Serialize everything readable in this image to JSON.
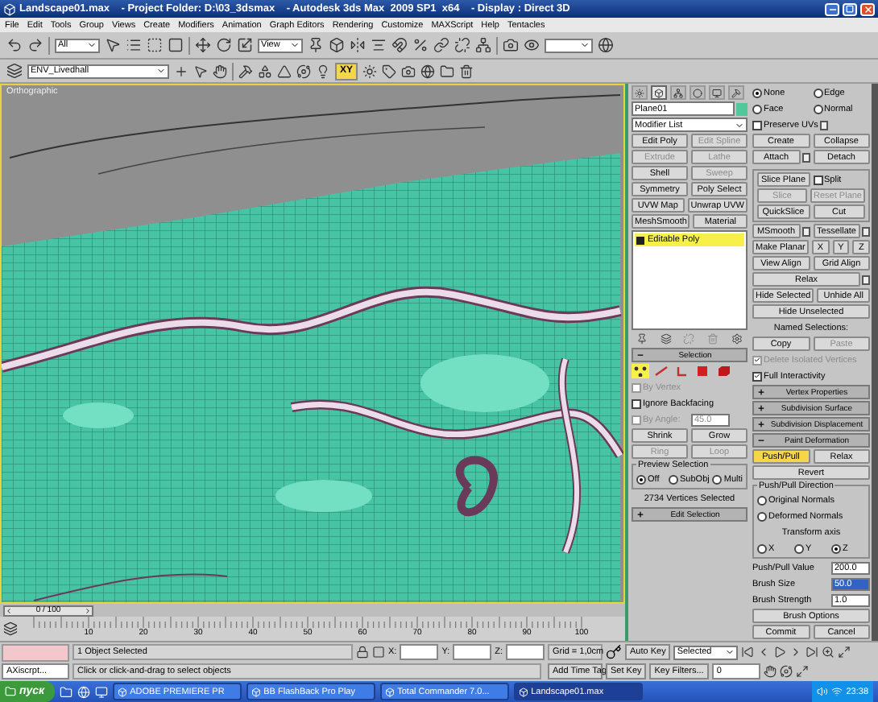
{
  "window": {
    "title": "Landscape01.max    - Project Folder: D:\\03_3dsmax    - Autodesk 3ds Max  2009 SP1  x64    - Display : Direct 3D"
  },
  "menu": [
    "File",
    "Edit",
    "Tools",
    "Group",
    "Views",
    "Create",
    "Modifiers",
    "Animation",
    "Graph Editors",
    "Rendering",
    "Customize",
    "MAXScript",
    "Help",
    "Tentacles"
  ],
  "main_toolbar": {
    "selection_filter": "All",
    "coordinate_system": "View"
  },
  "layer_toolbar": {
    "layer": "ENV_Livedhall",
    "constraint": {
      "label": "XY",
      "selected": true
    }
  },
  "viewport": {
    "label": "Orthographic"
  },
  "command_panel": {
    "tabs": [
      {
        "selected": false
      },
      {
        "selected": true
      },
      {
        "selected": false
      },
      {
        "selected": false
      },
      {
        "selected": false
      },
      {
        "selected": false
      }
    ],
    "left": [
      {
        "kind": "row",
        "items": [
          {
            "kind": "field",
            "value": "Plane01",
            "color": "#52c79c"
          }
        ]
      },
      {
        "kind": "row",
        "items": [
          {
            "kind": "dropdown",
            "value": "Modifier List"
          }
        ]
      },
      {
        "kind": "row",
        "items": [
          {
            "kind": "button",
            "label": "Edit Poly",
            "disabled": false
          },
          {
            "kind": "button",
            "label": "Edit Spline",
            "disabled": true
          }
        ]
      },
      {
        "kind": "row",
        "items": [
          {
            "kind": "button",
            "label": "Extrude",
            "disabled": true
          },
          {
            "kind": "button",
            "label": "Lathe",
            "disabled": true
          }
        ]
      },
      {
        "kind": "row",
        "items": [
          {
            "kind": "button",
            "label": "Shell",
            "disabled": false
          },
          {
            "kind": "button",
            "label": "Sweep",
            "disabled": true
          }
        ]
      },
      {
        "kind": "row",
        "items": [
          {
            "kind": "button",
            "label": "Symmetry",
            "disabled": false
          },
          {
            "kind": "button",
            "label": "Poly Select",
            "disabled": false
          }
        ]
      },
      {
        "kind": "row",
        "items": [
          {
            "kind": "button",
            "label": "UVW Map",
            "disabled": false
          },
          {
            "kind": "button",
            "label": "Unwrap UVW",
            "disabled": false
          }
        ]
      },
      {
        "kind": "row",
        "items": [
          {
            "kind": "button",
            "label": "MeshSmooth",
            "disabled": false
          },
          {
            "kind": "button",
            "label": "Material",
            "disabled": false
          }
        ]
      },
      {
        "kind": "stack",
        "items": [
          {
            "label": "Editable Poly",
            "selected": true
          }
        ]
      },
      {
        "kind": "stack-tools"
      },
      {
        "kind": "rollout",
        "title": "Selection",
        "expanded": true
      },
      {
        "kind": "subobjects",
        "items": [
          {
            "selected": true
          },
          {
            "selected": false
          },
          {
            "selected": false
          },
          {
            "selected": false
          },
          {
            "selected": false
          }
        ]
      },
      {
        "kind": "row",
        "items": [
          {
            "kind": "checkbox",
            "label": "By Vertex",
            "checked": false,
            "disabled": true
          }
        ]
      },
      {
        "kind": "row",
        "items": [
          {
            "kind": "checkbox",
            "label": "Ignore Backfacing",
            "checked": false,
            "disabled": false
          }
        ]
      },
      {
        "kind": "row",
        "items": [
          {
            "kind": "checkbox",
            "label": "By Angle:",
            "checked": false,
            "disabled": true
          },
          {
            "kind": "spinner",
            "value": "45.0",
            "focused": false,
            "disabled": true
          }
        ]
      },
      {
        "kind": "row",
        "items": [
          {
            "kind": "button",
            "label": "Shrink",
            "disabled": false
          },
          {
            "kind": "button",
            "label": "Grow",
            "disabled": false
          }
        ]
      },
      {
        "kind": "row",
        "items": [
          {
            "kind": "button",
            "label": "Ring",
            "disabled": true
          },
          {
            "kind": "button",
            "label": "Loop",
            "disabled": true
          }
        ]
      },
      {
        "kind": "group",
        "title": "Preview Selection",
        "rows": [
          {
            "kind": "row",
            "items": [
              {
                "kind": "radio",
                "label": "Off",
                "selected": true
              },
              {
                "kind": "radio",
                "label": "SubObj",
                "selected": false
              },
              {
                "kind": "radio",
                "label": "Multi",
                "selected": false
              }
            ]
          }
        ]
      },
      {
        "kind": "row",
        "items": [
          {
            "kind": "label",
            "text": "2734 Vertices Selected",
            "disabled": false
          }
        ]
      },
      {
        "kind": "rollout",
        "title": "Edit Selection",
        "expanded": false
      }
    ],
    "right": [
      {
        "kind": "row",
        "items": [
          {
            "kind": "radio",
            "label": "None",
            "selected": true
          },
          {
            "kind": "radio",
            "label": "Edge",
            "selected": false
          }
        ]
      },
      {
        "kind": "row",
        "items": [
          {
            "kind": "radio",
            "label": "Face",
            "selected": false
          },
          {
            "kind": "radio",
            "label": "Normal",
            "selected": false
          }
        ]
      },
      {
        "kind": "row",
        "items": [
          {
            "kind": "checkbox",
            "label": "Preserve UVs",
            "checked": false,
            "disabled": false,
            "settings": true
          }
        ]
      },
      {
        "kind": "row",
        "items": [
          {
            "kind": "button",
            "label": "Create",
            "disabled": false
          },
          {
            "kind": "button",
            "label": "Collapse",
            "disabled": false
          }
        ]
      },
      {
        "kind": "row",
        "items": [
          {
            "kind": "button",
            "label": "Attach",
            "disabled": false,
            "settings": true
          },
          {
            "kind": "button",
            "label": "Detach",
            "disabled": false
          }
        ]
      },
      {
        "kind": "group",
        "rows": [
          {
            "kind": "row",
            "items": [
              {
                "kind": "button",
                "label": "Slice Plane",
                "disabled": false
              },
              {
                "kind": "checkbox",
                "label": "Split",
                "checked": false,
                "disabled": false
              }
            ]
          },
          {
            "kind": "row",
            "items": [
              {
                "kind": "button",
                "label": "Slice",
                "disabled": true
              },
              {
                "kind": "button",
                "label": "Reset Plane",
                "disabled": true
              }
            ]
          },
          {
            "kind": "row",
            "items": [
              {
                "kind": "button",
                "label": "QuickSlice",
                "disabled": false
              },
              {
                "kind": "button",
                "label": "Cut",
                "disabled": false
              }
            ]
          }
        ]
      },
      {
        "kind": "row",
        "items": [
          {
            "kind": "button",
            "label": "MSmooth",
            "disabled": false,
            "settings": true
          },
          {
            "kind": "button",
            "label": "Tessellate",
            "disabled": false,
            "settings": true
          }
        ]
      },
      {
        "kind": "row",
        "items": [
          {
            "kind": "button",
            "label": "Make Planar",
            "disabled": false
          },
          {
            "kind": "button",
            "label": "X",
            "disabled": false
          },
          {
            "kind": "button",
            "label": "Y",
            "disabled": false
          },
          {
            "kind": "button",
            "label": "Z",
            "disabled": false
          }
        ]
      },
      {
        "kind": "row",
        "items": [
          {
            "kind": "button",
            "label": "View Align",
            "disabled": false
          },
          {
            "kind": "button",
            "label": "Grid Align",
            "disabled": false
          }
        ]
      },
      {
        "kind": "row",
        "items": [
          {
            "kind": "button",
            "label": "Relax",
            "disabled": false,
            "settings": true
          }
        ]
      },
      {
        "kind": "row",
        "items": [
          {
            "kind": "button",
            "label": "Hide Selected",
            "disabled": false
          },
          {
            "kind": "button",
            "label": "Unhide All",
            "disabled": false
          }
        ]
      },
      {
        "kind": "row",
        "items": [
          {
            "kind": "button",
            "label": "Hide Unselected",
            "disabled": false
          }
        ]
      },
      {
        "kind": "row",
        "items": [
          {
            "kind": "label",
            "text": "Named Selections:",
            "disabled": false
          }
        ]
      },
      {
        "kind": "row",
        "items": [
          {
            "kind": "button",
            "label": "Copy",
            "disabled": false
          },
          {
            "kind": "button",
            "label": "Paste",
            "disabled": true
          }
        ]
      },
      {
        "kind": "row",
        "items": [
          {
            "kind": "checkbox",
            "label": "Delete Isolated Vertices",
            "checked": true,
            "disabled": true
          }
        ]
      },
      {
        "kind": "row",
        "items": [
          {
            "kind": "checkbox",
            "label": "Full Interactivity",
            "checked": true,
            "disabled": false
          }
        ]
      },
      {
        "kind": "rollout",
        "title": "Vertex Properties",
        "expanded": false
      },
      {
        "kind": "rollout",
        "title": "Subdivision Surface",
        "expanded": false
      },
      {
        "kind": "rollout",
        "title": "Subdivision Displacement",
        "expanded": false
      },
      {
        "kind": "rollout",
        "title": "Paint Deformation",
        "expanded": true
      },
      {
        "kind": "row",
        "items": [
          {
            "kind": "button",
            "label": "Push/Pull",
            "disabled": false,
            "selected": true
          },
          {
            "kind": "button",
            "label": "Relax",
            "disabled": false,
            "selected": false
          }
        ]
      },
      {
        "kind": "row",
        "items": [
          {
            "kind": "button",
            "label": "Revert",
            "disabled": false
          }
        ]
      },
      {
        "kind": "group",
        "title": "Push/Pull Direction",
        "rows": [
          {
            "kind": "row",
            "items": [
              {
                "kind": "radio",
                "label": "Original Normals",
                "selected": false
              }
            ]
          },
          {
            "kind": "row",
            "items": [
              {
                "kind": "radio",
                "label": "Deformed Normals",
                "selected": false
              }
            ]
          },
          {
            "kind": "row",
            "items": [
              {
                "kind": "label",
                "text": "Transform axis",
                "disabled": false
              }
            ]
          },
          {
            "kind": "row",
            "items": [
              {
                "kind": "radio",
                "label": "X",
                "selected": false
              },
              {
                "kind": "radio",
                "label": "Y",
                "selected": false
              },
              {
                "kind": "radio",
                "label": "Z",
                "selected": true
              }
            ]
          }
        ]
      },
      {
        "kind": "row",
        "items": [
          {
            "kind": "spinner",
            "label": "Push/Pull Value",
            "value": "200.0",
            "focused": false,
            "disabled": false
          }
        ]
      },
      {
        "kind": "row",
        "items": [
          {
            "kind": "spinner",
            "label": "Brush Size",
            "value": "50.0",
            "focused": true
          }
        ]
      },
      {
        "kind": "row",
        "items": [
          {
            "kind": "spinner",
            "label": "Brush Strength",
            "value": "1.0",
            "focused": false,
            "disabled": false
          }
        ]
      },
      {
        "kind": "row",
        "items": [
          {
            "kind": "button",
            "label": "Brush Options",
            "disabled": false
          }
        ]
      },
      {
        "kind": "row",
        "items": [
          {
            "kind": "button",
            "label": "Commit",
            "disabled": false
          },
          {
            "kind": "button",
            "label": "Cancel",
            "disabled": false
          }
        ]
      }
    ]
  },
  "time_slider": {
    "label": "0 / 100"
  },
  "timeline": {
    "ticks": [
      "10",
      "20",
      "30",
      "40",
      "50",
      "60",
      "70",
      "80",
      "90",
      "100"
    ]
  },
  "status_bar": {
    "listener": "AXiscrpt...",
    "selection": "1 Object Selected",
    "prompt": "Click or click-and-drag to select objects",
    "coords": [
      {
        "axis": "X:"
      },
      {
        "axis": "Y:"
      },
      {
        "axis": "Z:"
      }
    ],
    "grid": "Grid = 1,0cm",
    "time_tag": "Add Time Tag"
  },
  "animation_controls": {
    "auto_key": "Auto Key",
    "set_key": "Set Key",
    "key_mode": "Selected",
    "key_filters": "Key Filters...",
    "frame": "0"
  },
  "taskbar": {
    "start": "пуск",
    "tasks": [
      {
        "label": "ADOBE PREMIERE PR",
        "selected": false
      },
      {
        "label": "BB FlashBack Pro Play",
        "selected": false
      },
      {
        "label": "Total Commander 7.0...",
        "selected": false
      },
      {
        "label": "Landscape01.max",
        "selected": true
      }
    ],
    "clock": "23:38"
  }
}
